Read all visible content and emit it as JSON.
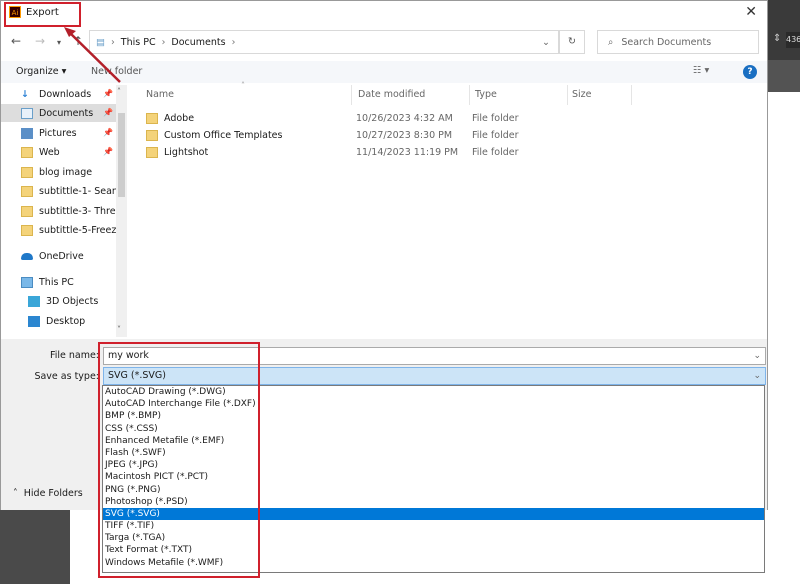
{
  "background": {
    "property_value": "436"
  },
  "dialog": {
    "title": "Export",
    "app_icon": "Ai",
    "breadcrumb": [
      "This PC",
      "Documents"
    ],
    "search_placeholder": "Search Documents",
    "toolbar": {
      "organize": "Organize",
      "new_folder": "New folder"
    },
    "sidebar": [
      {
        "label": "Downloads",
        "icon": "download-icon",
        "pinned": true
      },
      {
        "label": "Documents",
        "icon": "documents-icon",
        "pinned": true,
        "selected": true
      },
      {
        "label": "Pictures",
        "icon": "pictures-icon",
        "pinned": true
      },
      {
        "label": "Web",
        "icon": "folder-icon",
        "pinned": true
      },
      {
        "label": "blog image",
        "icon": "folder-icon"
      },
      {
        "label": "subtittle-1- Sean",
        "icon": "folder-icon"
      },
      {
        "label": "subtittle-3- Thre",
        "icon": "folder-icon"
      },
      {
        "label": "subtittle-5-Freez",
        "icon": "folder-icon"
      },
      {
        "label": "OneDrive",
        "icon": "cloud-icon"
      },
      {
        "label": "This PC",
        "icon": "computer-icon"
      },
      {
        "label": "3D Objects",
        "icon": "cube-icon"
      },
      {
        "label": "Desktop",
        "icon": "desktop-icon"
      }
    ],
    "columns": [
      "Name",
      "Date modified",
      "Type",
      "Size"
    ],
    "files": [
      {
        "name": "Adobe",
        "date": "10/26/2023 4:32 AM",
        "type": "File folder"
      },
      {
        "name": "Custom Office Templates",
        "date": "10/27/2023 8:30 PM",
        "type": "File folder"
      },
      {
        "name": "Lightshot",
        "date": "11/14/2023 11:19 PM",
        "type": "File folder"
      }
    ],
    "file_name_label": "File name:",
    "file_name_value": "my work",
    "save_type_label": "Save as type:",
    "save_type_value": "SVG (*.SVG)",
    "type_options": [
      "AutoCAD Drawing (*.DWG)",
      "AutoCAD Interchange File (*.DXF)",
      "BMP (*.BMP)",
      "CSS (*.CSS)",
      "Enhanced Metafile (*.EMF)",
      "Flash (*.SWF)",
      "JPEG (*.JPG)",
      "Macintosh PICT (*.PCT)",
      "PNG (*.PNG)",
      "Photoshop (*.PSD)",
      "SVG (*.SVG)",
      "TIFF (*.TIF)",
      "Targa (*.TGA)",
      "Text Format (*.TXT)",
      "Windows Metafile (*.WMF)"
    ],
    "selected_option_index": 10,
    "hide_folders": "Hide Folders"
  }
}
